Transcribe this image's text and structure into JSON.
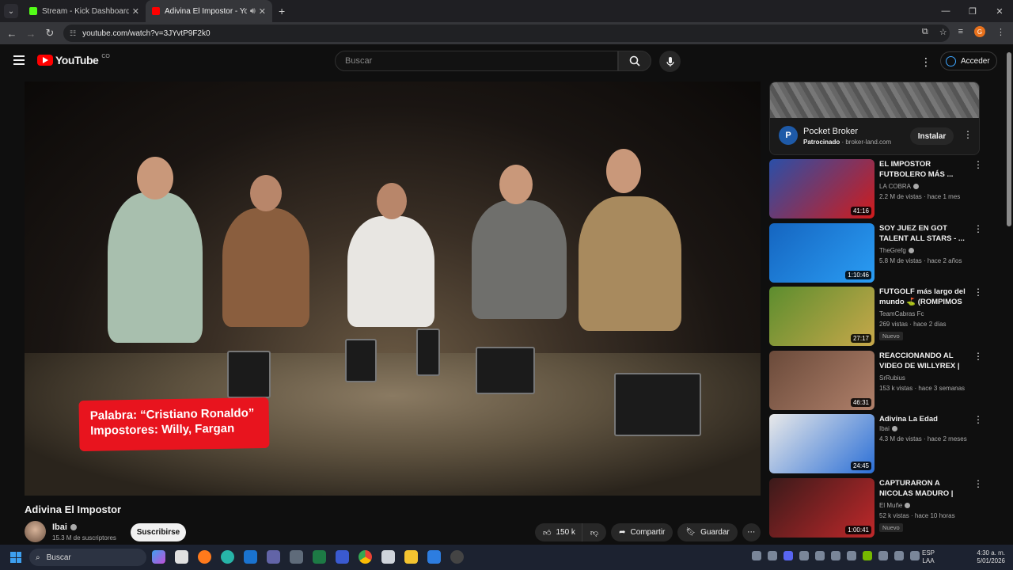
{
  "browser": {
    "tabs": [
      {
        "title": "Stream - Kick Dashboard",
        "favicon_color": "#53fc18"
      },
      {
        "title": "Adivina El Impostor - YouTube",
        "favicon_color": "#ff0000"
      }
    ],
    "url": "youtube.com/watch?v=3JYvtP9F2k0",
    "profile_initial": "G"
  },
  "header": {
    "logo_text": "YouTube",
    "country": "CO",
    "search_placeholder": "Buscar",
    "signin_label": "Acceder"
  },
  "video": {
    "caption_line1": "Palabra: “Cristiano Ronaldo”",
    "caption_line2": "Impostores: Willy, Fargan",
    "title": "Adivina El Impostor",
    "channel": "Ibai",
    "subscribers": "15.3 M de suscriptores",
    "subscribe_label": "Suscribirse",
    "likes": "150 k",
    "share_label": "Compartir",
    "save_label": "Guardar"
  },
  "ad": {
    "logo_letter": "P",
    "name": "Pocket Broker",
    "sponsored": "Patrocinado",
    "domain": "broker-land.com",
    "install_label": "Instalar"
  },
  "recommendations": [
    {
      "title": "EL IMPOSTOR FUTBOLERO MÁS ...",
      "channel": "LA COBRA",
      "verified": true,
      "meta": "2.2 M de vistas · hace 1 mes",
      "duration": "41:16",
      "badge": "",
      "thumb_colors": [
        "#2a4fa8",
        "#d11b1b"
      ]
    },
    {
      "title": "SOY JUEZ EN GOT TALENT ALL STARS - ...",
      "channel": "TheGrefg",
      "verified": true,
      "meta": "5.8 M de vistas · hace 2 años",
      "duration": "1:10:46",
      "badge": "",
      "thumb_colors": [
        "#1565c0",
        "#2a9df4"
      ]
    },
    {
      "title": "FUTGOLF más largo del mundo ⛳ (ROMPIMOS ...",
      "channel": "TeamCabras Fc",
      "verified": false,
      "meta": "269 vistas · hace 2 días",
      "duration": "27:17",
      "badge": "Nuevo",
      "thumb_colors": [
        "#5c8d2e",
        "#c8a84a"
      ]
    },
    {
      "title": "REACCIONANDO AL VIDEO DE WILLYREX | ...",
      "channel": "SrRubius",
      "verified": false,
      "meta": "153 k vistas · hace 3 semanas",
      "duration": "46:31",
      "badge": "",
      "thumb_colors": [
        "#6a4a3a",
        "#b0806a"
      ]
    },
    {
      "title": "Adivina La Edad",
      "channel": "Ibai",
      "verified": true,
      "meta": "4.3 M de vistas · hace 2 meses",
      "duration": "24:45",
      "badge": "",
      "thumb_colors": [
        "#e9e9e9",
        "#2b6fd6"
      ]
    },
    {
      "title": "CAPTURARON A NICOLAS MADURO | Recuento, ...",
      "channel": "El Muñe",
      "verified": true,
      "meta": "52 k vistas · hace 10 horas",
      "duration": "1:00:41",
      "badge": "Nuevo",
      "thumb_colors": [
        "#3a1a1a",
        "#c0282a"
      ]
    }
  ],
  "taskbar": {
    "search_label": "Buscar",
    "lang_line1": "ESP",
    "lang_line2": "LAA",
    "time": "4:30 a. m.",
    "date": "5/01/2026"
  }
}
